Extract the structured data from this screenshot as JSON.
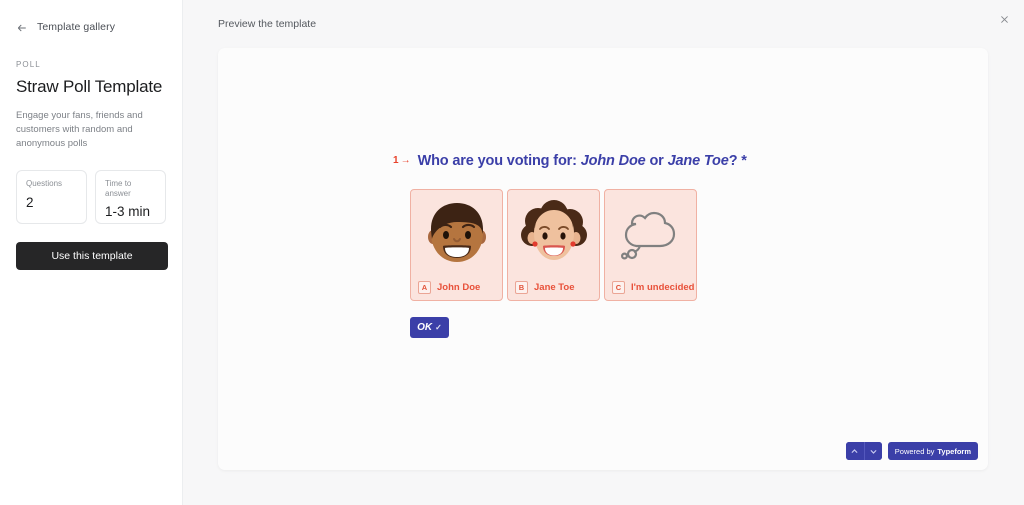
{
  "sidebar": {
    "back_label": "Template gallery",
    "kicker": "POLL",
    "title": "Straw Poll Template",
    "description": "Engage your fans, friends and customers with random and anonymous polls",
    "stats": [
      {
        "label": "Questions",
        "value": "2"
      },
      {
        "label": "Time to answer",
        "value": "1-3 min"
      }
    ],
    "cta_label": "Use this template"
  },
  "header": {
    "title": "Preview the template",
    "close_icon": "close-icon"
  },
  "form": {
    "question_number": "1",
    "question_arrow": "→",
    "question_prefix": "Who are you voting for:",
    "question_name_a": "John Doe",
    "question_conjunction": "or",
    "question_name_b": "Jane Toe",
    "question_suffix": "?",
    "required_marker": "*",
    "choices": [
      {
        "key": "A",
        "label": "John Doe",
        "art": "man-face-emoji"
      },
      {
        "key": "B",
        "label": "Jane Toe",
        "art": "woman-face-emoji"
      },
      {
        "key": "C",
        "label": "I'm undecided",
        "art": "thought-cloud-icon"
      }
    ],
    "ok_label": "OK",
    "ok_check": "✓"
  },
  "controls": {
    "nav_up_icon": "chevron-up-icon",
    "nav_down_icon": "chevron-down-icon",
    "powered_prefix": "Powered by",
    "powered_brand": "Typeform"
  },
  "colors": {
    "accent_blue": "#3b3fa8",
    "accent_red": "#e8513a",
    "card_bg": "#fbe4de",
    "card_border": "#f0b1a3",
    "cta_dark": "#262627"
  }
}
